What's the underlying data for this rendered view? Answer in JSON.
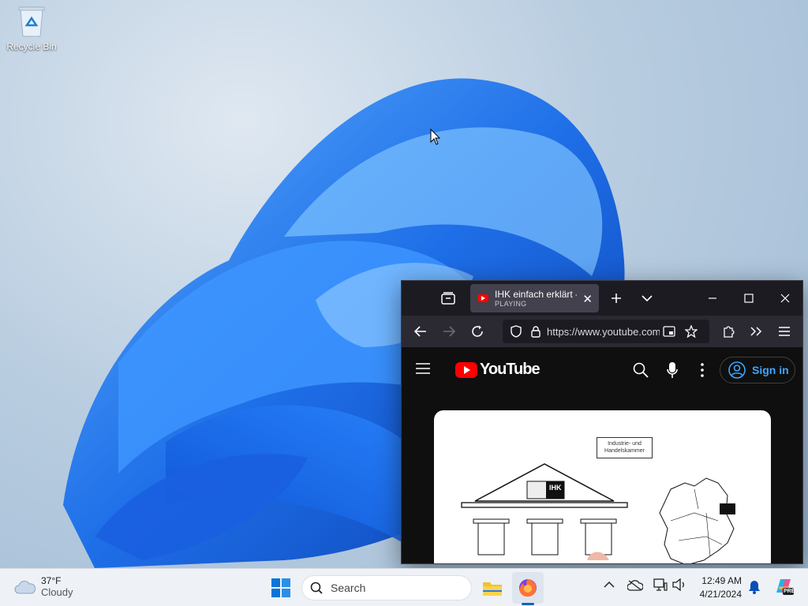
{
  "desktop": {
    "icons": [
      {
        "label": "Recycle Bin"
      }
    ]
  },
  "browser": {
    "tab": {
      "title": "IHK einfach erklärt -",
      "status": "PLAYING"
    },
    "url": "https://www.youtube.com",
    "youtube": {
      "logo_text": "YouTube",
      "sign_in": "Sign in",
      "video_box_text": [
        "Industrie- und",
        "Handelskammer"
      ],
      "building_sign": "IHK"
    }
  },
  "taskbar": {
    "weather": {
      "temp": "37°F",
      "condition": "Cloudy"
    },
    "search_placeholder": "Search",
    "clock": {
      "time": "12:49 AM",
      "date": "4/21/2024"
    },
    "copilot_badge": "PRE"
  },
  "colors": {
    "accent": "#0067c0",
    "youtube_red": "#ff0000",
    "signin_blue": "#3ea6ff"
  }
}
